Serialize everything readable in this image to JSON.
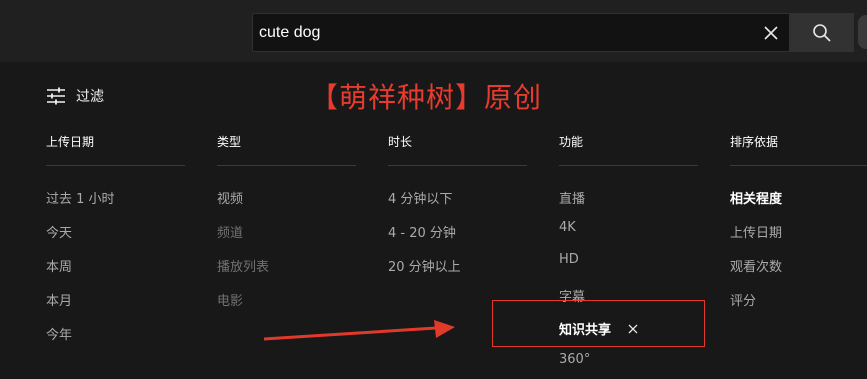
{
  "search": {
    "value": "cute dog",
    "clear_icon": "close-icon",
    "search_icon": "search-icon"
  },
  "filter": {
    "label": "过滤",
    "icon": "sliders-icon"
  },
  "watermark": "【萌祥种树】原创",
  "columns": {
    "upload_date": {
      "header": "上传日期",
      "items": [
        "过去 1 小时",
        "今天",
        "本周",
        "本月",
        "今年"
      ]
    },
    "type": {
      "header": "类型",
      "items": [
        "视频",
        "频道",
        "播放列表",
        "电影"
      ]
    },
    "duration": {
      "header": "时长",
      "items": [
        "4 分钟以下",
        "4 - 20 分钟",
        "20 分钟以上"
      ]
    },
    "features": {
      "header": "功能",
      "items": [
        "直播",
        "4K",
        "HD",
        "字幕",
        "知识共享",
        "360°"
      ]
    },
    "sort_by": {
      "header": "排序依据",
      "items": [
        "相关程度",
        "上传日期",
        "观看次数",
        "评分"
      ]
    }
  },
  "colors": {
    "background": "#181818",
    "topbar": "#202020",
    "annotation_red": "#e23a2a",
    "watermark_red": "#e63b2e",
    "active_text": "#ffffff",
    "inactive_text": "#aaaaaa",
    "disabled_text": "#717171"
  }
}
